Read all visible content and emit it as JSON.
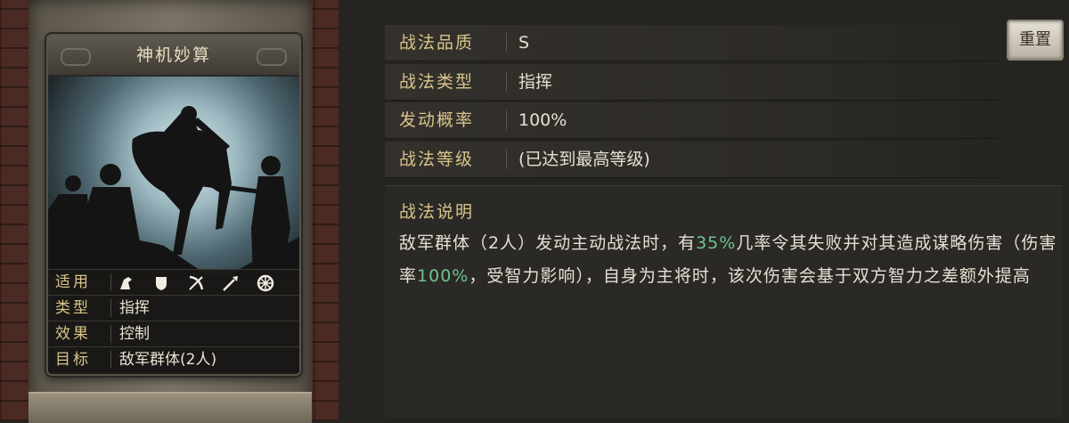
{
  "card": {
    "title": "神机妙算",
    "attributes": [
      {
        "label": "适用",
        "icons": [
          "cavalry-icon",
          "shield-icon",
          "bow-icon",
          "spear-icon",
          "siege-icon"
        ]
      },
      {
        "label": "类型",
        "value": "指挥"
      },
      {
        "label": "效果",
        "value": "控制"
      },
      {
        "label": "目标",
        "value": "敌军群体(2人)"
      }
    ]
  },
  "reset_button": "重置",
  "stats": [
    {
      "label": "战法品质",
      "value": "S"
    },
    {
      "label": "战法类型",
      "value": "指挥"
    },
    {
      "label": "发动概率",
      "value": "100%"
    },
    {
      "label": "战法等级",
      "value": "(已达到最高等级)"
    }
  ],
  "description": {
    "heading": "战法说明",
    "segments": [
      {
        "text": "敌军群体（2人）发动主动战法时，有"
      },
      {
        "text": "35%",
        "highlight": true
      },
      {
        "text": "几率令其失败并对其造成谋略伤害（伤害率"
      },
      {
        "text": "100%",
        "highlight": true
      },
      {
        "text": "，受智力影响），自身为主将时，该次伤害会基于双方智力之差额外提高"
      }
    ]
  },
  "colors": {
    "label_gold": "#d8c48a",
    "highlight_green": "#6fc38f",
    "text": "#e6e0d2"
  }
}
